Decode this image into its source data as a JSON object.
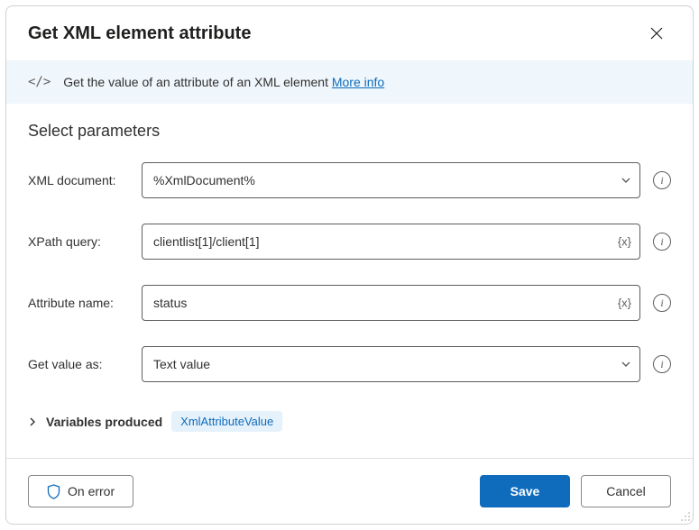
{
  "header": {
    "title": "Get XML element attribute"
  },
  "banner": {
    "text": "Get the value of an attribute of an XML element",
    "more_info_label": "More info"
  },
  "section": {
    "title": "Select parameters"
  },
  "fields": {
    "xml_document": {
      "label": "XML document:",
      "value": "%XmlDocument%"
    },
    "xpath_query": {
      "label": "XPath query:",
      "value": "clientlist[1]/client[1]",
      "adornment": "{x}"
    },
    "attribute_name": {
      "label": "Attribute name:",
      "value": "status",
      "adornment": "{x}"
    },
    "get_value_as": {
      "label": "Get value as:",
      "value": "Text value"
    }
  },
  "variables": {
    "label": "Variables produced",
    "chip": "XmlAttributeValue"
  },
  "footer": {
    "on_error": "On error",
    "save": "Save",
    "cancel": "Cancel"
  }
}
